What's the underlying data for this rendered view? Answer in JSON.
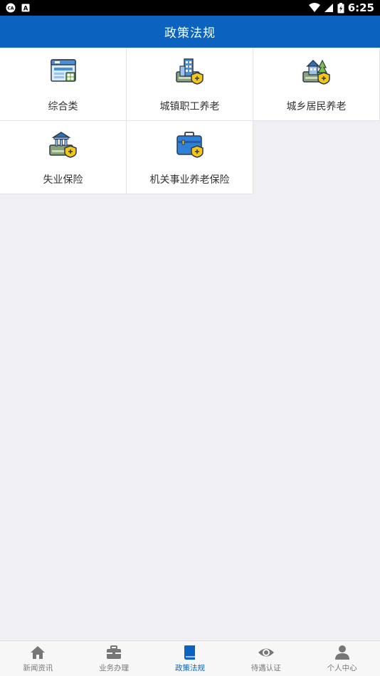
{
  "status_bar": {
    "time": "6:25",
    "icons": [
      "ca-icon",
      "a-icon",
      "wifi-icon",
      "signal-icon",
      "battery-icon"
    ]
  },
  "app_bar": {
    "title": "政策法规"
  },
  "categories": [
    {
      "label": "综合类",
      "icon": "general-doc-icon"
    },
    {
      "label": "城镇职工养老",
      "icon": "urban-building-icon"
    },
    {
      "label": "城乡居民养老",
      "icon": "rural-house-icon"
    },
    {
      "label": "失业保险",
      "icon": "bank-shield-icon"
    },
    {
      "label": "机关事业养老保险",
      "icon": "briefcase-shield-icon"
    }
  ],
  "bottom_nav": {
    "items": [
      {
        "label": "新闻资讯",
        "icon": "home-icon",
        "active": false
      },
      {
        "label": "业务办理",
        "icon": "briefcase-icon",
        "active": false
      },
      {
        "label": "政策法规",
        "icon": "book-icon",
        "active": true
      },
      {
        "label": "待遇认证",
        "icon": "eye-icon",
        "active": false
      },
      {
        "label": "个人中心",
        "icon": "person-icon",
        "active": false
      }
    ],
    "active_color": "#0b63bf",
    "inactive_color": "#777777"
  },
  "colors": {
    "app_bar": "#0b63bf",
    "background": "#efeff4"
  }
}
